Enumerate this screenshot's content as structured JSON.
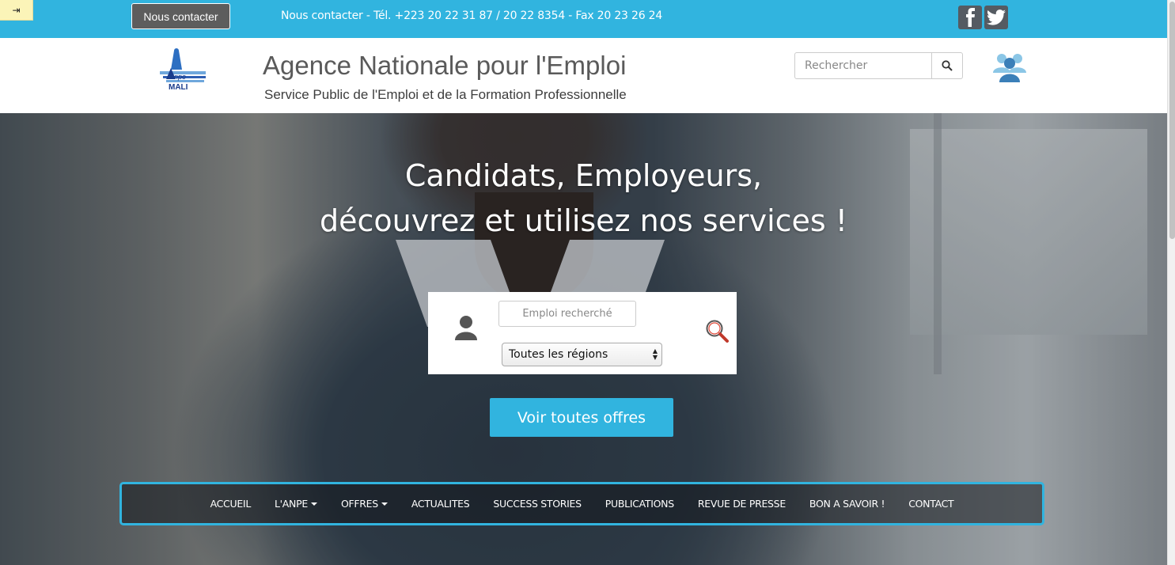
{
  "topbar": {
    "toggle_glyph": "⇥",
    "contact_button": "Nous contacter",
    "contact_info": "Nous contacter - Tél. +223 20 22 31 87 / 20 22 8354 - Fax 20 23 26 24",
    "social": [
      "facebook-icon",
      "twitter-icon"
    ],
    "bg_color": "#31b4df"
  },
  "header": {
    "logo_text": "MALI",
    "title": "Agence Nationale pour l'Emploi",
    "subtitle": "Service Public de l'Emploi et de la Formation Professionnelle",
    "search_placeholder": "Rechercher"
  },
  "hero": {
    "line1": "Candidats, Employeurs,",
    "line2": "découvrez et utilisez nos services !",
    "job_placeholder": "Emploi recherché",
    "region_selected": "Toutes les régions",
    "all_offers_button": "Voir toutes offres"
  },
  "nav": {
    "items": [
      {
        "label": "ACCUEIL",
        "dropdown": false
      },
      {
        "label": "L'ANPE",
        "dropdown": true
      },
      {
        "label": "OFFRES",
        "dropdown": true
      },
      {
        "label": "ACTUALITES",
        "dropdown": false
      },
      {
        "label": "SUCCESS STORIES",
        "dropdown": false
      },
      {
        "label": "PUBLICATIONS",
        "dropdown": false
      },
      {
        "label": "REVUE DE PRESSE",
        "dropdown": false
      },
      {
        "label": "BON A SAVOIR !",
        "dropdown": false
      },
      {
        "label": "CONTACT",
        "dropdown": false
      }
    ]
  },
  "colors": {
    "accent": "#31b4df",
    "button_dark": "#5d5d5d"
  }
}
